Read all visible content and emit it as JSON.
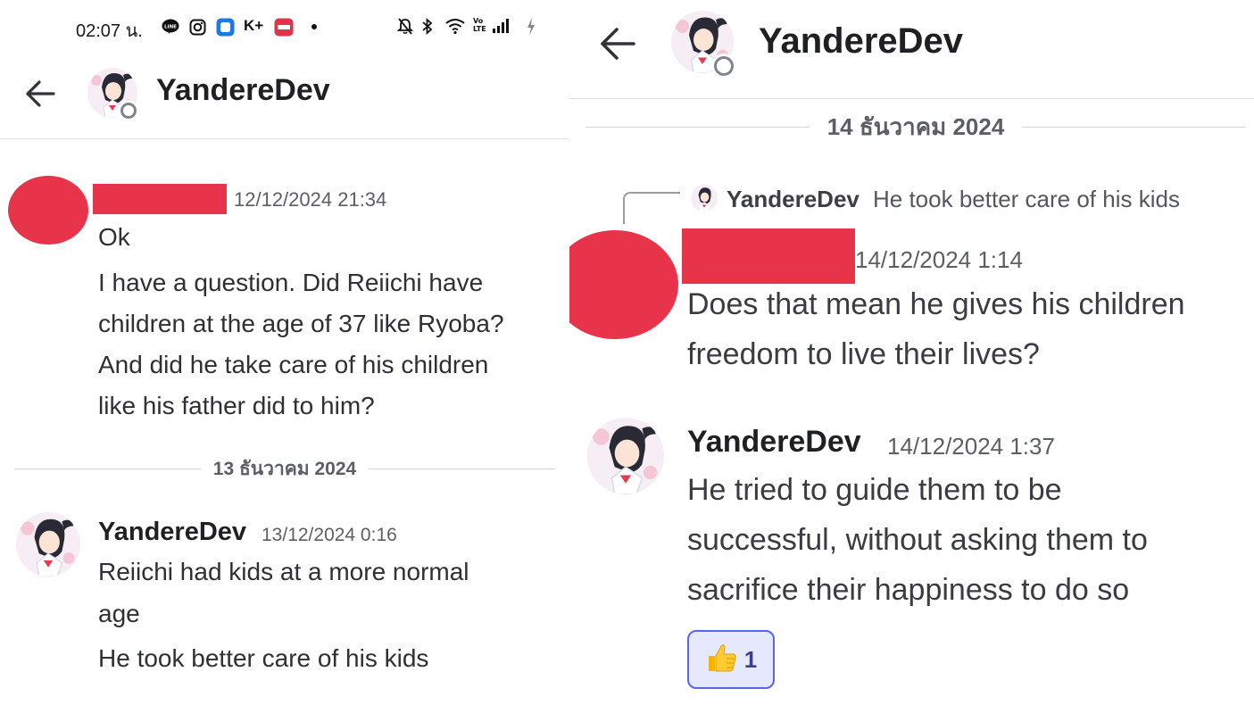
{
  "status_bar": {
    "time": "02:07 น.",
    "app_icons": [
      "line-icon",
      "instagram-icon",
      "app-square-icon",
      "kplus-icon",
      "news-app-icon",
      "dot"
    ],
    "right_icons": [
      "mute-bell-icon",
      "bluetooth-icon",
      "wifi-icon",
      "volte-icon",
      "signal-icon",
      "battery-charging-icon"
    ]
  },
  "left": {
    "header": {
      "title": "YandereDev"
    },
    "message1": {
      "timestamp": "12/12/2024 21:34",
      "lines": [
        "Ok",
        "I have a question. Did Reiichi have",
        "children at the age of 37 like Ryoba?",
        "And did he take care of his children",
        "like his father did to him?"
      ]
    },
    "date_separator": "13 ธันวาคม 2024",
    "message2": {
      "author": "YandereDev",
      "timestamp": "13/12/2024 0:16",
      "lines": [
        "Reiichi had kids at a more normal",
        "age",
        "He took better care of his kids"
      ]
    }
  },
  "right": {
    "header": {
      "title": "YandereDev"
    },
    "date_separator": "14 ธันวาคม 2024",
    "reply_preview": {
      "author": "YandereDev",
      "text": "He took better care of his kids"
    },
    "message1": {
      "timestamp": "14/12/2024 1:14",
      "lines": [
        "Does that mean he gives his children",
        "freedom to live their lives?"
      ]
    },
    "message2": {
      "author": "YandereDev",
      "timestamp": "14/12/2024 1:37",
      "lines": [
        "He tried to guide them to be",
        "successful, without asking them to",
        "sacrifice their happiness to do so"
      ]
    },
    "reaction": {
      "emoji": "thumbs-up-icon",
      "count": "1"
    }
  },
  "colors": {
    "redaction": "#e8344a",
    "text": "#2e3035",
    "muted": "#5c5e66",
    "reaction_border": "#5865f2",
    "reaction_bg": "#e6e9fd"
  }
}
